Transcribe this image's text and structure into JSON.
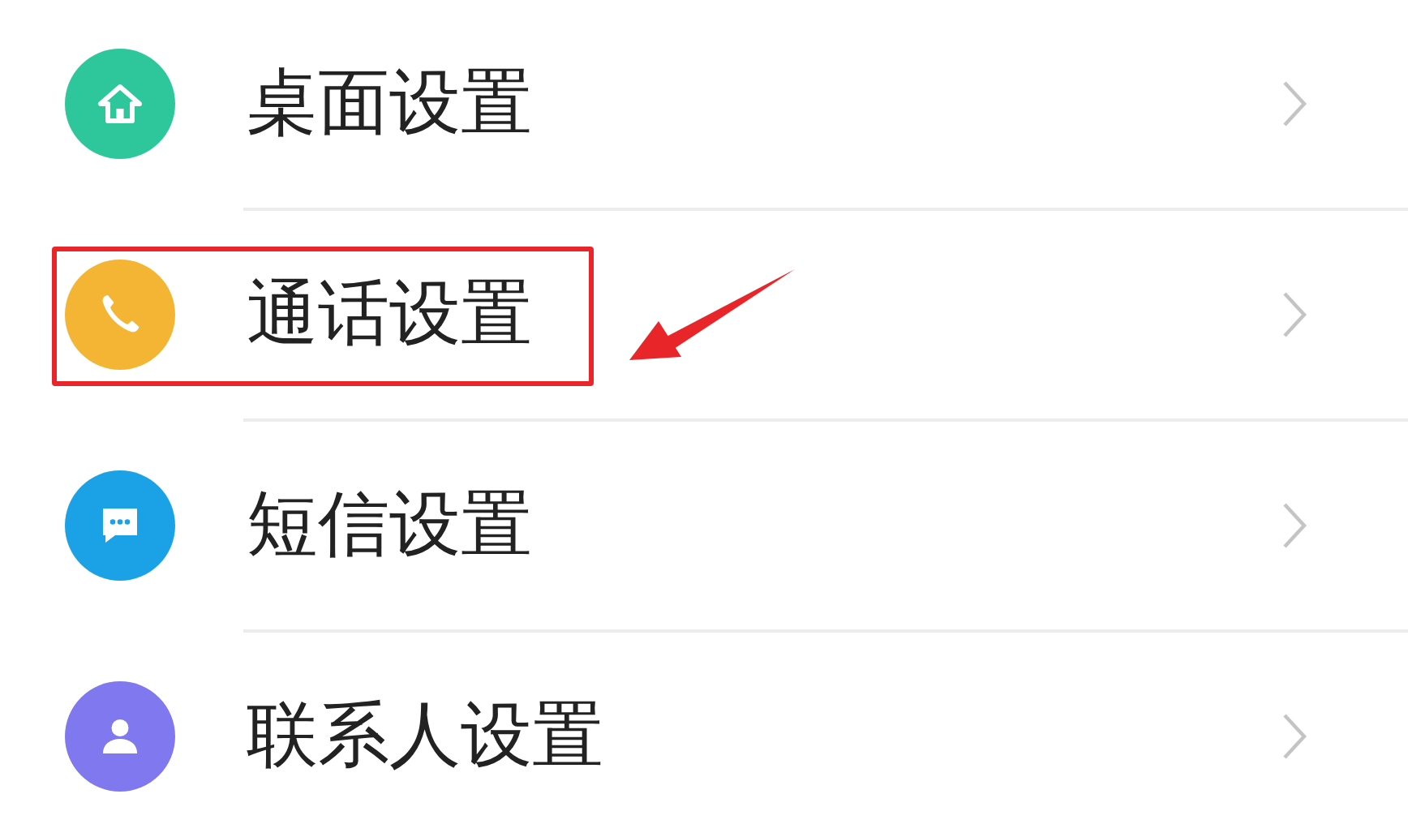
{
  "items": [
    {
      "label": "桌面设置",
      "kind": "home",
      "color": "#2ec79b",
      "highlighted": false
    },
    {
      "label": "通话设置",
      "kind": "phone",
      "color": "#f4b534",
      "highlighted": true
    },
    {
      "label": "短信设置",
      "kind": "message",
      "color": "#1ba2e6",
      "highlighted": false
    },
    {
      "label": "联系人设置",
      "kind": "person",
      "color": "#8078ee",
      "highlighted": false
    }
  ]
}
